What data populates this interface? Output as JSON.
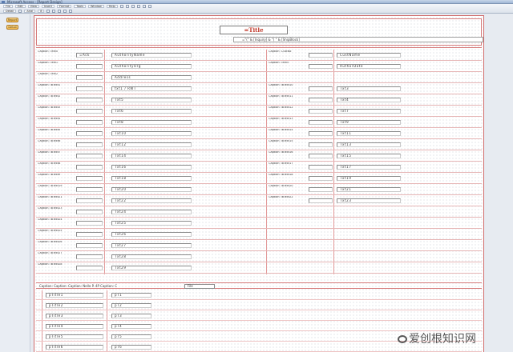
{
  "window": {
    "title": "Microsoft Access - [Report Design]"
  },
  "toolbar": {
    "row1": [
      "File",
      "Edit",
      "View",
      "Insert",
      "Format",
      "Tools",
      "Window",
      "Help",
      "",
      "",
      "",
      "",
      "",
      ""
    ],
    "row2": [
      "Detail",
      "",
      "Arial",
      "8",
      "",
      "",
      "",
      "",
      ""
    ]
  },
  "sidebar": {
    "buttons": [
      "Report",
      "Detail"
    ]
  },
  "header": {
    "title": "=Title",
    "subtitle": "=\"(\" & [Inquiry] & \") \" & [ShipBlock]"
  },
  "rows": [
    {
      "l1": "Caption: Text0",
      "v1": "=Ack",
      "v2": "AuthorityName",
      "l2": "Caption: CustNo",
      "v3": "",
      "v4": "CustName"
    },
    {
      "l1": "Caption: Text1",
      "v1": "",
      "v2": "AuthorityOrg",
      "l2": "Caption: Text5",
      "v3": "",
      "v4": "AuthorDate"
    },
    {
      "l1": "Caption: Text2",
      "v1": "",
      "v2": "Address",
      "l2": "",
      "v3": "",
      "v4": ""
    },
    {
      "l1": "Caption: lbText1",
      "v1": "",
      "v2": "txt1 / RWT",
      "l2": "Caption: lbText10",
      "v3": "",
      "v4": "Txt3"
    },
    {
      "l1": "Caption: lbText2",
      "v1": "",
      "v2": "Txt5",
      "l2": "Caption: lbText11",
      "v3": "",
      "v4": "Txt4"
    },
    {
      "l1": "Caption: lbText3",
      "v1": "",
      "v2": "Txt6",
      "l2": "Caption: lbText12",
      "v3": "",
      "v4": "Txt7"
    },
    {
      "l1": "Caption: lbText4",
      "v1": "",
      "v2": "Txt8",
      "l2": "Caption: lbText13",
      "v3": "",
      "v4": "Txt9"
    },
    {
      "l1": "Caption: lbText5",
      "v1": "",
      "v2": "Txt10",
      "l2": "Caption: lbText14",
      "v3": "",
      "v4": "Txt11"
    },
    {
      "l1": "Caption: lbText6",
      "v1": "",
      "v2": "Txt12",
      "l2": "Caption: lbText15",
      "v3": "",
      "v4": "Txt13"
    },
    {
      "l1": "Caption: lbText7",
      "v1": "",
      "v2": "Txt14",
      "l2": "Caption: lbText16",
      "v3": "",
      "v4": "Txt15"
    },
    {
      "l1": "Caption: lbText8",
      "v1": "",
      "v2": "Txt16",
      "l2": "Caption: lbText17",
      "v3": "",
      "v4": "Txt17"
    },
    {
      "l1": "Caption: lbText9",
      "v1": "",
      "v2": "Txt18",
      "l2": "Caption: lbText18",
      "v3": "",
      "v4": "Txt19"
    },
    {
      "l1": "Caption: lbText19",
      "v1": "",
      "v2": "Txt20",
      "l2": "Caption: lbText20",
      "v3": "",
      "v4": "Txt21"
    },
    {
      "l1": "Caption: lbText21",
      "v1": "",
      "v2": "Txt22",
      "l2": "Caption: lbText22",
      "v3": "",
      "v4": "Txt23"
    },
    {
      "l1": "Caption: lbText23",
      "v1": "",
      "v2": "Txt24",
      "l2": "",
      "v3": "",
      "v4": ""
    },
    {
      "l1": "Caption: lbText24",
      "v1": "",
      "v2": "Txt25",
      "l2": "",
      "v3": "",
      "v4": ""
    },
    {
      "l1": "Caption: lbText25",
      "v1": "",
      "v2": "Txt26",
      "l2": "",
      "v3": "",
      "v4": ""
    },
    {
      "l1": "Caption: lbText26",
      "v1": "",
      "v2": "Txt27",
      "l2": "",
      "v3": "",
      "v4": ""
    },
    {
      "l1": "Caption: lbText27",
      "v1": "",
      "v2": "Txt28",
      "l2": "",
      "v3": "",
      "v4": ""
    },
    {
      "l1": "Caption: lbText28",
      "v1": "",
      "v2": "Txt29",
      "l2": "",
      "v3": "",
      "v4": ""
    }
  ],
  "footer": {
    "band_text": "Caption: Caption: Caption: Nelle P. 4P   Caption: C",
    "box": "File",
    "rows": [
      {
        "label": "pTitle1",
        "value": "pT1"
      },
      {
        "label": "pTitle2",
        "value": "pT2"
      },
      {
        "label": "pTitle3",
        "value": "pT3"
      },
      {
        "label": "pTitle4",
        "value": "pT4"
      },
      {
        "label": "pTitle5",
        "value": "pT5"
      },
      {
        "label": "pTitle6",
        "value": "pT6"
      }
    ]
  },
  "watermark": {
    "text": "爱创根知识网"
  }
}
